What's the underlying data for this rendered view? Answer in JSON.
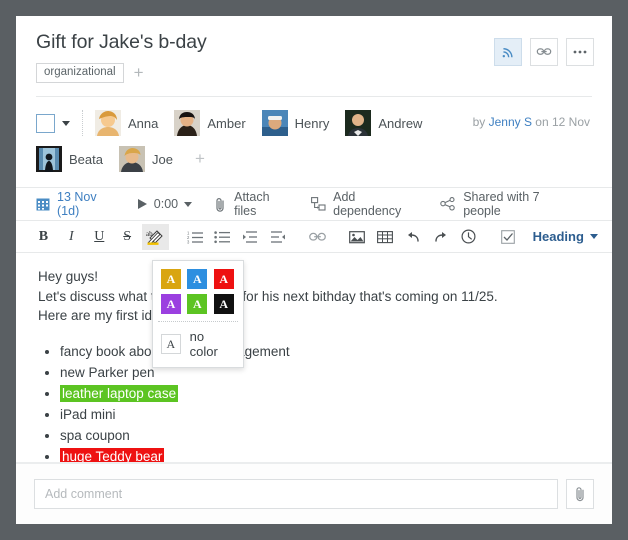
{
  "header": {
    "title": "Gift for Jake's b-day",
    "tag": "organizational",
    "tag_add": "+",
    "buttons": [
      {
        "name": "subscribe",
        "icon": "rss-icon"
      },
      {
        "name": "link",
        "icon": "link-icon"
      },
      {
        "name": "more",
        "icon": "ellipsis-icon"
      }
    ]
  },
  "assignees": {
    "row1": [
      {
        "name": "Anna"
      },
      {
        "name": "Amber"
      },
      {
        "name": "Henry"
      },
      {
        "name": "Andrew"
      }
    ],
    "row2": [
      {
        "name": "Beata"
      },
      {
        "name": "Joe"
      }
    ],
    "add_label": "+",
    "byline_prefix": "by ",
    "byline_author": "Jenny S",
    "byline_suffix": " on 12 Nov"
  },
  "meta": {
    "date": "13 Nov (1d)",
    "timer": "0:00",
    "attach": "Attach files",
    "dependency": "Add dependency",
    "shared": "Shared with 7 people"
  },
  "toolbar": {
    "bold": "B",
    "italic": "I",
    "underline": "U",
    "strike": "S",
    "heading": "Heading"
  },
  "editor": {
    "line1": "Hey guys!",
    "line2": "Let's discuss what to buy as a gift for his next bithday that's coming on 11/25.",
    "line3": "Here are my first ideas:",
    "items": [
      {
        "text": "fancy book about project management",
        "highlight": ""
      },
      {
        "text": "new Parker pen",
        "highlight": ""
      },
      {
        "text": "leather laptop case",
        "highlight": "#5cc422"
      },
      {
        "text": "iPad mini",
        "highlight": ""
      },
      {
        "text": "spa coupon",
        "highlight": ""
      },
      {
        "text": "huge Teddy bear",
        "highlight": "#ee1111"
      }
    ]
  },
  "color_menu": {
    "letter": "A",
    "swatches": [
      {
        "name": "gold",
        "color": "#d9a511"
      },
      {
        "name": "blue",
        "color": "#2d8fe0"
      },
      {
        "name": "red",
        "color": "#ee1111"
      },
      {
        "name": "purple",
        "color": "#9b3fe0"
      },
      {
        "name": "green",
        "color": "#5cc422"
      },
      {
        "name": "black",
        "color": "#111111"
      }
    ],
    "no_color_label": "no color"
  },
  "footer": {
    "comment_placeholder": "Add comment"
  }
}
